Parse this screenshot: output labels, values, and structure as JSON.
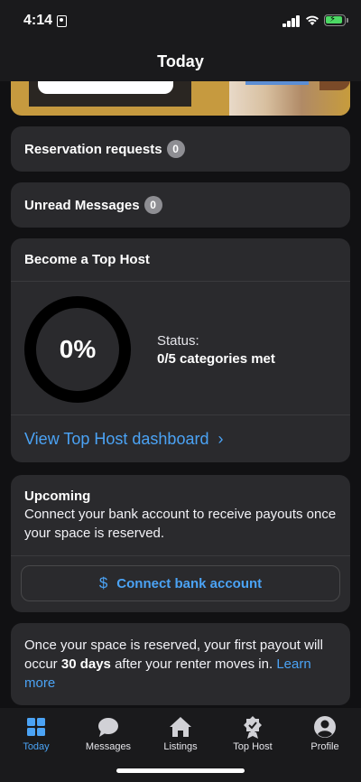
{
  "status_bar": {
    "time": "4:14"
  },
  "header": {
    "title": "Today"
  },
  "reservation_requests": {
    "label": "Reservation requests",
    "count": "0"
  },
  "unread_messages": {
    "label": "Unread Messages",
    "count": "0"
  },
  "top_host": {
    "title": "Become a Top Host",
    "progress_text": "0%",
    "progress_value": 0,
    "status_label": "Status:",
    "status_value": "0/5 categories met",
    "link": "View Top Host dashboard"
  },
  "upcoming": {
    "title": "Upcoming",
    "text": "Connect your bank account to receive payouts once your space is reserved.",
    "button": "Connect bank account"
  },
  "payout": {
    "text_before": "Once your space is reserved, your first payout will occur ",
    "bold": "30 days",
    "text_after": " after your renter moves in. ",
    "link": "Learn more"
  },
  "tabs": [
    {
      "label": "Today",
      "icon": "grid-icon",
      "active": true
    },
    {
      "label": "Messages",
      "icon": "chat-bubble-icon",
      "active": false
    },
    {
      "label": "Listings",
      "icon": "house-icon",
      "active": false
    },
    {
      "label": "Top Host",
      "icon": "badge-icon",
      "active": false
    },
    {
      "label": "Profile",
      "icon": "person-icon",
      "active": false
    }
  ],
  "colors": {
    "accent": "#4ba3f5",
    "background": "#111113",
    "card": "#2a2a2d"
  }
}
